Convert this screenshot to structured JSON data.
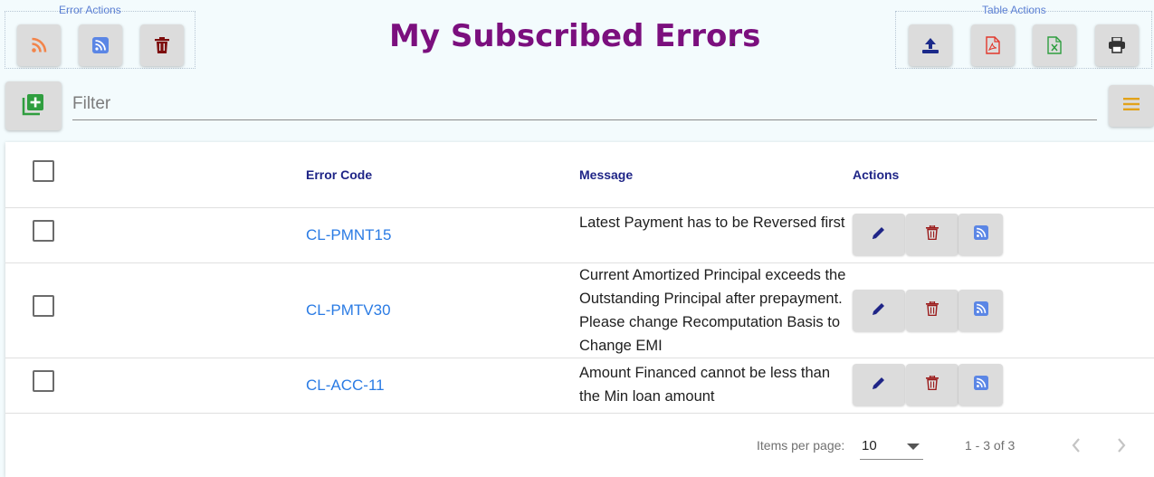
{
  "header": {
    "title": "My Subscribed Errors",
    "error_actions_label": "Error Actions",
    "table_actions_label": "Table Actions"
  },
  "error_actions": [
    {
      "name": "rss-button",
      "icon": "rss-icon",
      "color": "#f2844a"
    },
    {
      "name": "rss-square-button",
      "icon": "rss-square-icon",
      "color": "#5b86e5"
    },
    {
      "name": "delete-button",
      "icon": "trash-icon",
      "color": "#7d0d0d"
    }
  ],
  "table_actions": [
    {
      "name": "upload-button",
      "icon": "upload-icon",
      "color": "#1b2a8a"
    },
    {
      "name": "export-pdf-button",
      "icon": "file-pdf-icon",
      "color": "#e2372b"
    },
    {
      "name": "export-excel-button",
      "icon": "file-excel-icon",
      "color": "#2f9e3f"
    },
    {
      "name": "print-button",
      "icon": "print-icon",
      "color": "#333333"
    }
  ],
  "toolbar": {
    "add_icon": "add-box-icon",
    "filter_placeholder": "Filter",
    "filter_value": "",
    "menu_icon": "menu-icon"
  },
  "table": {
    "columns": [
      "Error Code",
      "Message",
      "Actions"
    ],
    "rows": [
      {
        "code": "CL-PMNT15",
        "message": "Latest Payment has to be Reversed first"
      },
      {
        "code": "CL-PMTV30",
        "message": "Current Amortized Principal exceeds the Outstanding Principal after prepayment. Please change Recomputation Basis to Change EMI"
      },
      {
        "code": "CL-ACC-11",
        "message": "Amount Financed cannot be less than the Min loan amount"
      }
    ],
    "row_action_icons": [
      "edit-icon",
      "trash-icon",
      "rss-square-icon"
    ]
  },
  "pagination": {
    "items_per_page_label": "Items per page:",
    "items_per_page": "10",
    "range": "1 - 3 of 3"
  },
  "colors": {
    "title": "#7b0f7e",
    "header_text": "#1f2587",
    "link": "#2a7be4",
    "add_icon": "#2f9e3f",
    "menu_icon": "#e2a21a"
  }
}
